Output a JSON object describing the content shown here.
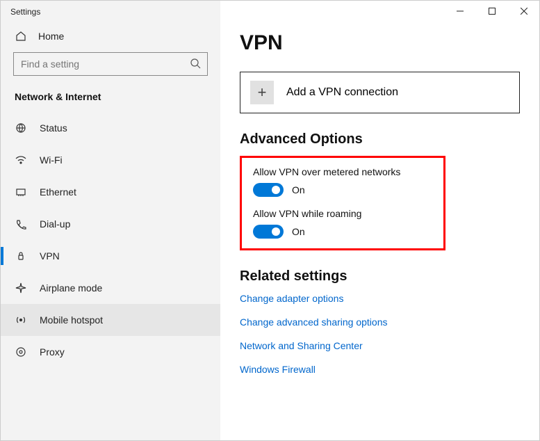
{
  "window": {
    "title": "Settings"
  },
  "sidebar": {
    "home": "Home",
    "search_placeholder": "Find a setting",
    "section": "Network & Internet",
    "items": [
      {
        "label": "Status"
      },
      {
        "label": "Wi-Fi"
      },
      {
        "label": "Ethernet"
      },
      {
        "label": "Dial-up"
      },
      {
        "label": "VPN"
      },
      {
        "label": "Airplane mode"
      },
      {
        "label": "Mobile hotspot"
      },
      {
        "label": "Proxy"
      }
    ]
  },
  "page": {
    "title": "VPN",
    "add_connection": "Add a VPN connection",
    "advanced_heading": "Advanced Options",
    "toggle1_label": "Allow VPN over metered networks",
    "toggle1_state": "On",
    "toggle2_label": "Allow VPN while roaming",
    "toggle2_state": "On",
    "related_heading": "Related settings",
    "links": {
      "adapter": "Change adapter options",
      "sharing": "Change advanced sharing options",
      "center": "Network and Sharing Center",
      "firewall": "Windows Firewall"
    }
  }
}
